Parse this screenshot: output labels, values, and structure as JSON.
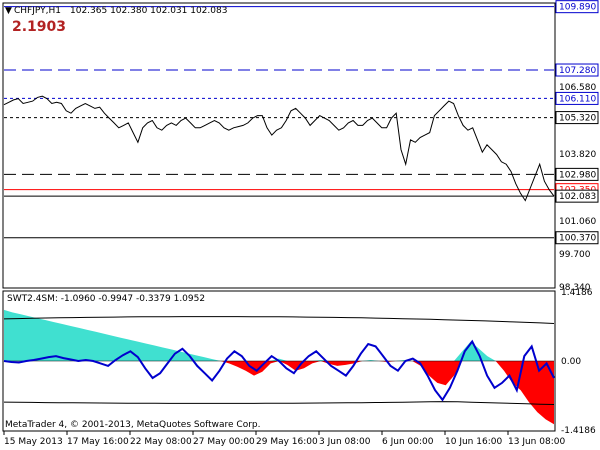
{
  "header": {
    "symbol_tf": "CHFJPY,H1",
    "ohlc": "102.365 102.380 102.031 102.083",
    "big_value": "2.1903"
  },
  "indicator": {
    "label": "SWT2.4SM: -1.0960 -0.9947 -0.3379 1.0952"
  },
  "copyright": "MetaTrader 4, © 2001-2013, MetaQuotes Software Corp.",
  "colors": {
    "price": "#000000",
    "level_blue": "#0000cd",
    "level_black": "#000000",
    "current_red": "#ff0000",
    "area_cyan": "#40e0d0",
    "area_red": "#ff0000",
    "signal_blue": "#0000cd"
  },
  "chart_data": [
    {
      "type": "line",
      "title": "CHFJPY,H1",
      "x": [
        "15 May 2013",
        "17 May 16:00",
        "22 May 08:00",
        "27 May 00:00",
        "29 May 16:00",
        "3 Jun 08:00",
        "6 Jun 00:00",
        "10 Jun 16:00",
        "13 Jun 08:00"
      ],
      "y_ticks": [
        "109.890",
        "107.280",
        "106.580",
        "106.110",
        "105.320",
        "103.820",
        "102.980",
        "102.350",
        "102.083",
        "101.060",
        "100.370",
        "99.700",
        "98.340"
      ],
      "ylim": [
        98.34,
        110.0
      ],
      "levels": [
        {
          "value": 109.89,
          "label": "109.890",
          "style": "solid",
          "color": "#0000cd"
        },
        {
          "value": 107.28,
          "label": "107.280",
          "style": "dashed-long",
          "color": "#0000cd"
        },
        {
          "value": 106.11,
          "label": "106.110",
          "style": "dashed",
          "color": "#0000cd"
        },
        {
          "value": 105.32,
          "label": "105.320",
          "style": "dashed",
          "color": "#000000"
        },
        {
          "value": 102.98,
          "label": "102.980",
          "style": "dashed-long",
          "color": "#000000"
        },
        {
          "value": 102.35,
          "label": "102.350",
          "style": "solid",
          "color": "#ff0000"
        },
        {
          "value": 102.083,
          "label": "102.083",
          "style": "solid",
          "color": "#000000"
        },
        {
          "value": 100.37,
          "label": "100.370",
          "style": "solid",
          "color": "#000000"
        }
      ],
      "series": [
        {
          "name": "CHFJPY,H1",
          "values": [
            105.85,
            105.95,
            106.05,
            106.1,
            105.9,
            105.95,
            106.0,
            106.15,
            106.2,
            106.1,
            105.9,
            105.95,
            105.9,
            105.6,
            105.5,
            105.7,
            105.8,
            105.9,
            105.8,
            105.7,
            105.75,
            105.5,
            105.3,
            105.1,
            104.9,
            105.0,
            105.1,
            104.7,
            104.3,
            104.9,
            105.1,
            105.2,
            104.9,
            104.8,
            105.0,
            105.1,
            105.0,
            105.2,
            105.3,
            105.1,
            104.9,
            104.9,
            105.0,
            105.1,
            105.2,
            105.1,
            104.9,
            104.8,
            104.9,
            104.95,
            105.0,
            105.1,
            105.3,
            105.4,
            105.4,
            104.9,
            104.6,
            104.8,
            104.9,
            105.2,
            105.6,
            105.7,
            105.5,
            105.3,
            105.0,
            105.2,
            105.4,
            105.3,
            105.2,
            105.0,
            104.8,
            104.9,
            105.1,
            105.2,
            105.0,
            105.0,
            105.2,
            105.3,
            105.1,
            104.9,
            104.9,
            105.3,
            105.5,
            104.0,
            103.4,
            104.4,
            104.3,
            104.5,
            104.6,
            104.7,
            105.4,
            105.6,
            105.8,
            106.0,
            105.9,
            105.4,
            105.0,
            104.8,
            104.9,
            104.4,
            103.9,
            104.2,
            104.0,
            103.8,
            103.5,
            103.4,
            103.1,
            102.6,
            102.2,
            101.9,
            102.4,
            102.9,
            103.4,
            102.7,
            102.35,
            102.08
          ]
        }
      ]
    },
    {
      "type": "area",
      "title": "SWT2.4SM",
      "x": [
        "15 May 2013",
        "17 May 16:00",
        "22 May 08:00",
        "27 May 00:00",
        "29 May 16:00",
        "3 Jun 08:00",
        "6 Jun 00:00",
        "10 Jun 16:00",
        "13 Jun 08:00"
      ],
      "y_ticks": [
        "1.4186",
        "0.00",
        "-1.4186"
      ],
      "ylim": [
        -1.4186,
        1.4186
      ],
      "series": [
        {
          "name": "",
          "values": [
            1.05,
            1.0,
            0.96,
            0.92,
            0.88,
            0.84,
            0.8,
            0.76,
            0.72,
            0.68,
            0.64,
            0.6,
            0.56,
            0.52,
            0.48,
            0.44,
            0.4,
            0.36,
            0.32,
            0.28,
            0.24,
            0.2,
            0.16,
            0.12,
            0.08,
            0.04,
            0.0,
            -0.05,
            -0.12,
            -0.2,
            -0.3,
            -0.22,
            -0.05,
            0.05,
            -0.08,
            -0.2,
            -0.15,
            -0.05,
            0.02,
            -0.06,
            -0.1,
            -0.08,
            -0.05,
            0.0,
            0.02,
            0.0,
            -0.02,
            0.0,
            0.02,
            0.0,
            -0.1,
            -0.3,
            -0.45,
            -0.5,
            -0.3,
            0.2,
            0.4,
            0.25,
            0.1,
            0.0,
            -0.2,
            -0.45,
            -0.6,
            -0.85,
            -1.05,
            -1.2,
            -1.3
          ]
        },
        {
          "name": "",
          "values": [
            0.0,
            -0.02,
            -0.03,
            0.0,
            0.02,
            0.05,
            0.08,
            0.1,
            0.06,
            0.03,
            0.0,
            0.02,
            0.0,
            -0.05,
            -0.1,
            0.02,
            0.12,
            0.2,
            0.08,
            -0.15,
            -0.35,
            -0.25,
            -0.05,
            0.15,
            0.25,
            0.1,
            -0.1,
            -0.25,
            -0.4,
            -0.2,
            0.05,
            0.2,
            0.1,
            -0.1,
            -0.2,
            -0.05,
            0.1,
            0.0,
            -0.15,
            -0.25,
            -0.05,
            0.1,
            0.2,
            0.05,
            -0.1,
            -0.2,
            -0.3,
            -0.1,
            0.15,
            0.35,
            0.3,
            0.1,
            -0.1,
            -0.2,
            0.0,
            0.05,
            -0.05,
            -0.3,
            -0.6,
            -0.8,
            -0.55,
            -0.2,
            0.2,
            0.4,
            0.1,
            -0.3,
            -0.55,
            -0.45,
            -0.3,
            -0.6,
            0.1,
            0.3,
            -0.2,
            -0.05,
            -0.35
          ]
        }
      ]
    }
  ]
}
